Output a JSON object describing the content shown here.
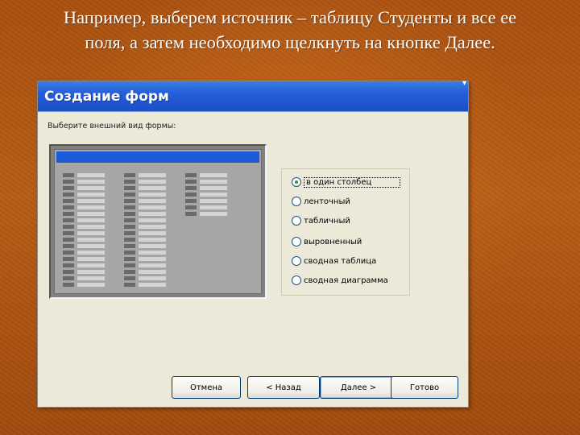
{
  "slide": {
    "caption_line1": "Например, выберем источник – таблицу Студенты и все ее",
    "caption_line2": "поля, а затем необходимо щелкнуть на кнопке Далее."
  },
  "dialog": {
    "title": "Создание форм",
    "prompt": "Выберите внешний вид формы:",
    "options": [
      {
        "label": "в один столбец",
        "selected": true
      },
      {
        "label": "ленточный",
        "selected": false
      },
      {
        "label": "табличный",
        "selected": false
      },
      {
        "label": "выровненный",
        "selected": false
      },
      {
        "label": "сводная таблица",
        "selected": false
      },
      {
        "label": "сводная диаграмма",
        "selected": false
      }
    ],
    "buttons": {
      "cancel": "Отмена",
      "back": "< Назад",
      "next": "Далее >",
      "finish": "Готово"
    }
  },
  "colors": {
    "title_bar": "#245edb",
    "preview_header": "#1c5ad8",
    "background": "#b55d16"
  }
}
